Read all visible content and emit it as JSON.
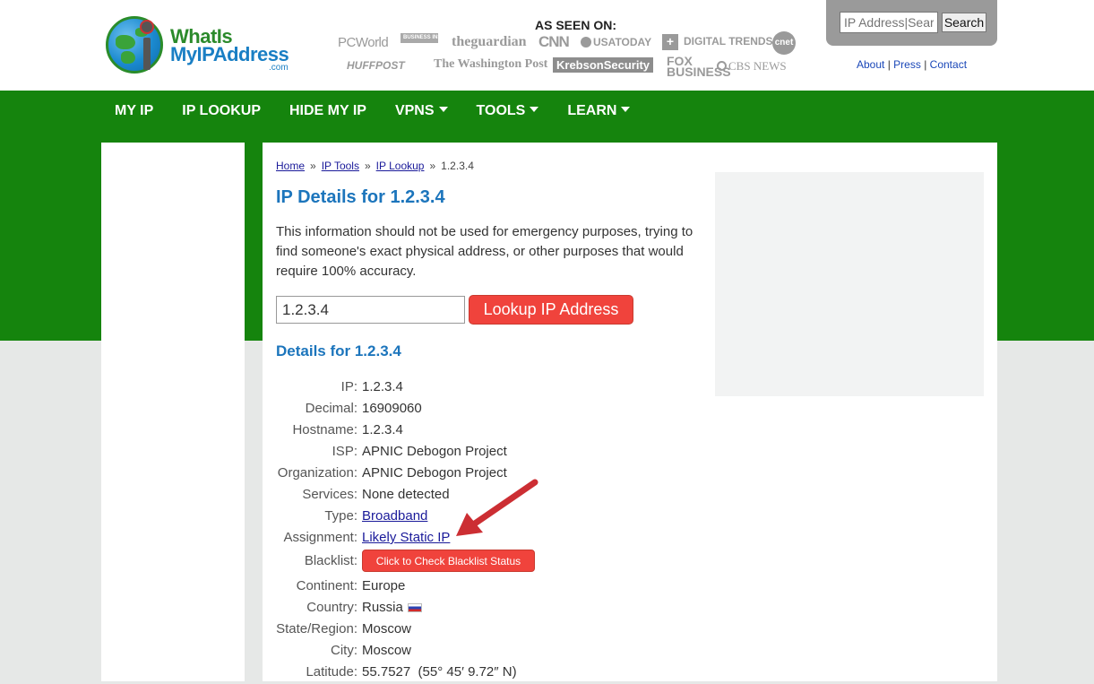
{
  "logo": {
    "line1": "WhatIs",
    "line2": "MyIPAddress",
    "line3": ".com"
  },
  "seen_on": {
    "title": "AS SEEN ON:",
    "outlets": [
      "PCWorld",
      "BUSINESS INSIDER",
      "theguardian",
      "CNN",
      "USATODAY",
      "DIGITAL TRENDS",
      "cnet",
      "HUFFPOST",
      "The Washington Post",
      "KrebsonSecurity",
      "FOX BUSINESS",
      "CBS NEWS"
    ]
  },
  "search": {
    "placeholder": "IP Address|Search",
    "button": "Search"
  },
  "top_links": {
    "about": "About",
    "press": "Press",
    "contact": "Contact",
    "sep": "|"
  },
  "nav": [
    "MY IP",
    "IP LOOKUP",
    "HIDE MY IP",
    "VPNS",
    "TOOLS",
    "LEARN"
  ],
  "breadcrumb": {
    "home": "Home",
    "ip_tools": "IP Tools",
    "ip_lookup": "IP Lookup",
    "current": "1.2.3.4",
    "sep": "»"
  },
  "main": {
    "title": "IP Details for 1.2.3.4",
    "disclaimer": "This information should not be used for emergency purposes, trying to find someone's exact physical address, or other purposes that would require 100% accuracy.",
    "lookup_value": "1.2.3.4",
    "lookup_button": "Lookup IP Address",
    "details_title": "Details for 1.2.3.4"
  },
  "details": [
    {
      "label": "IP:",
      "value": "1.2.3.4"
    },
    {
      "label": "Decimal:",
      "value": "16909060"
    },
    {
      "label": "Hostname:",
      "value": "1.2.3.4"
    },
    {
      "label": "ISP:",
      "value": "APNIC Debogon Project"
    },
    {
      "label": "Organization:",
      "value": "APNIC Debogon Project"
    },
    {
      "label": "Services:",
      "value": "None detected"
    },
    {
      "label": "Type:",
      "value": "Broadband"
    },
    {
      "label": "Assignment:",
      "value": "Likely Static IP"
    },
    {
      "label": "Blacklist:",
      "value": "Click to Check Blacklist Status"
    },
    {
      "label": "Continent:",
      "value": "Europe"
    },
    {
      "label": "Country:",
      "value": "Russia"
    },
    {
      "label": "State/Region:",
      "value": "Moscow"
    },
    {
      "label": "City:",
      "value": "Moscow"
    },
    {
      "label": "Latitude:",
      "value": "55.7527  (55° 45′ 9.72″ N)"
    }
  ],
  "colors": {
    "green": "#15840d",
    "accent_red": "#f0433c",
    "link_blue": "#1c75bc",
    "arrow": "#cc2e33"
  }
}
